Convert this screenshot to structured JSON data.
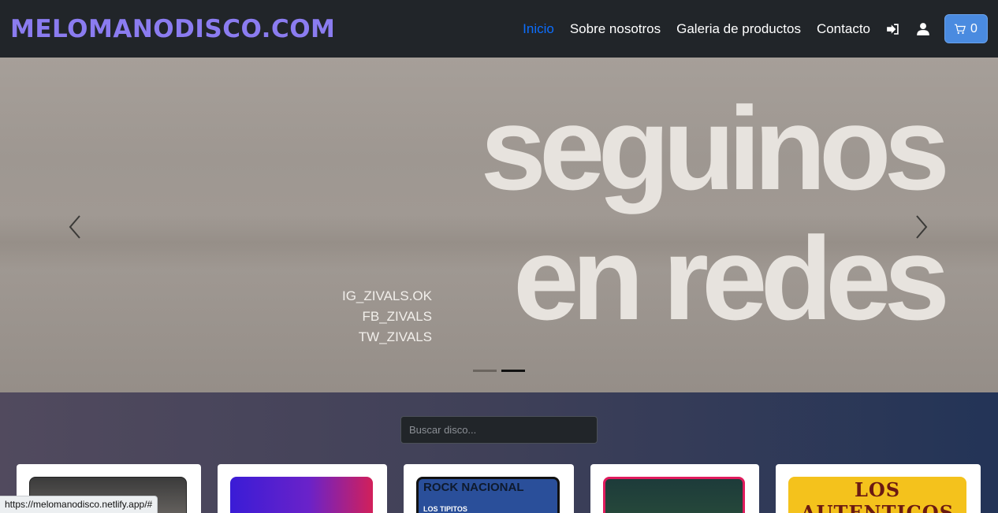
{
  "navbar": {
    "brand": "MELOMANODISCO.COM",
    "links": [
      "Inicio",
      "Sobre nosotros",
      "Galeria de productos",
      "Contacto"
    ],
    "login_icon": "sign-in-icon",
    "user_icon": "user-icon",
    "cart_icon": "cart-icon",
    "cart_count": "0",
    "active_color": "#0d6efd"
  },
  "carousel": {
    "headline_line1": "seguinos",
    "headline_line2": "en redes",
    "handles": [
      "IG_ZIVALS.OK",
      "FB_ZIVALS",
      "TW_ZIVALS"
    ],
    "slide_count": 2,
    "active_slide": 2
  },
  "search": {
    "placeholder": "Buscar disco..."
  },
  "cards": [
    {
      "cover_text": ""
    },
    {
      "cover_text": ""
    },
    {
      "cover_title": "ROCK NACIONAL",
      "cover_sub": "LOS TIPITOS"
    },
    {
      "cover_text": ""
    },
    {
      "cover_title": "LOS AUTENTICOS"
    }
  ],
  "status_bar": {
    "url": "https://melomanodisco.netlify.app/#"
  }
}
